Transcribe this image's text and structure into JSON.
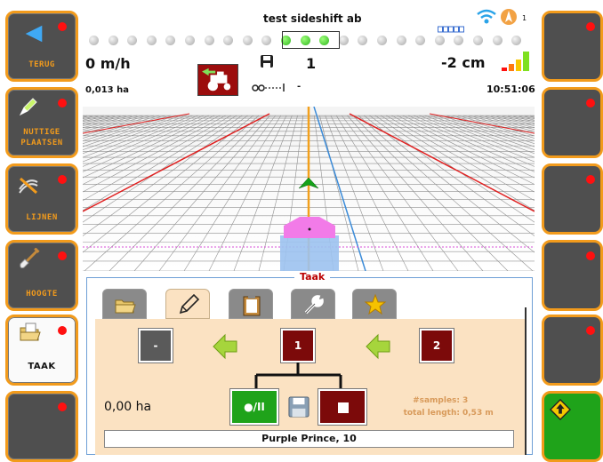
{
  "header": {
    "title": "test sideshift ab",
    "speed": "0 m/h",
    "area": "0,013 ha",
    "track_number": "1",
    "offset": "-2 cm",
    "clock": "10:51:06",
    "implement_status": "-",
    "satellite_count": "1",
    "lightbar_active_leds": 3
  },
  "left_nav": [
    {
      "label": "TERUG",
      "icon": "back-arrow-icon"
    },
    {
      "label": "NUTTIGE PLAATSEN",
      "label_line1": "NUTTIGE",
      "label_line2": "PLAATSEN",
      "icon": "marker-pen-icon"
    },
    {
      "label": "LIJNEN",
      "icon": "guidance-lines-icon"
    },
    {
      "label": "HOOGTE",
      "icon": "shovel-icon"
    },
    {
      "label": "TAAK",
      "icon": "folder-icon"
    },
    {
      "label": "",
      "icon": ""
    }
  ],
  "right_nav": [
    {
      "icon": ""
    },
    {
      "icon": ""
    },
    {
      "icon": ""
    },
    {
      "icon": ""
    },
    {
      "icon": ""
    },
    {
      "icon": "road-sign-up-icon"
    }
  ],
  "task_panel": {
    "title": "Taak",
    "tabs": [
      "folder-icon",
      "pencil-icon",
      "clipboard-icon",
      "wrench-icon",
      "star-icon"
    ],
    "nodes": [
      "-",
      "1",
      "2"
    ],
    "area": "0,00 ha",
    "samples_label": "#samples:",
    "samples_value": "3",
    "length_label": "total length:",
    "length_value": "0,53 m",
    "record_button": "●/II",
    "field_name": "Purple Prince, 10"
  },
  "colors": {
    "accent": "#f29b1c",
    "status_red": "#ff1010",
    "panel_bg": "#fbe2c2",
    "node_red": "#7c0a0a",
    "ok_green": "#1fa31a"
  }
}
